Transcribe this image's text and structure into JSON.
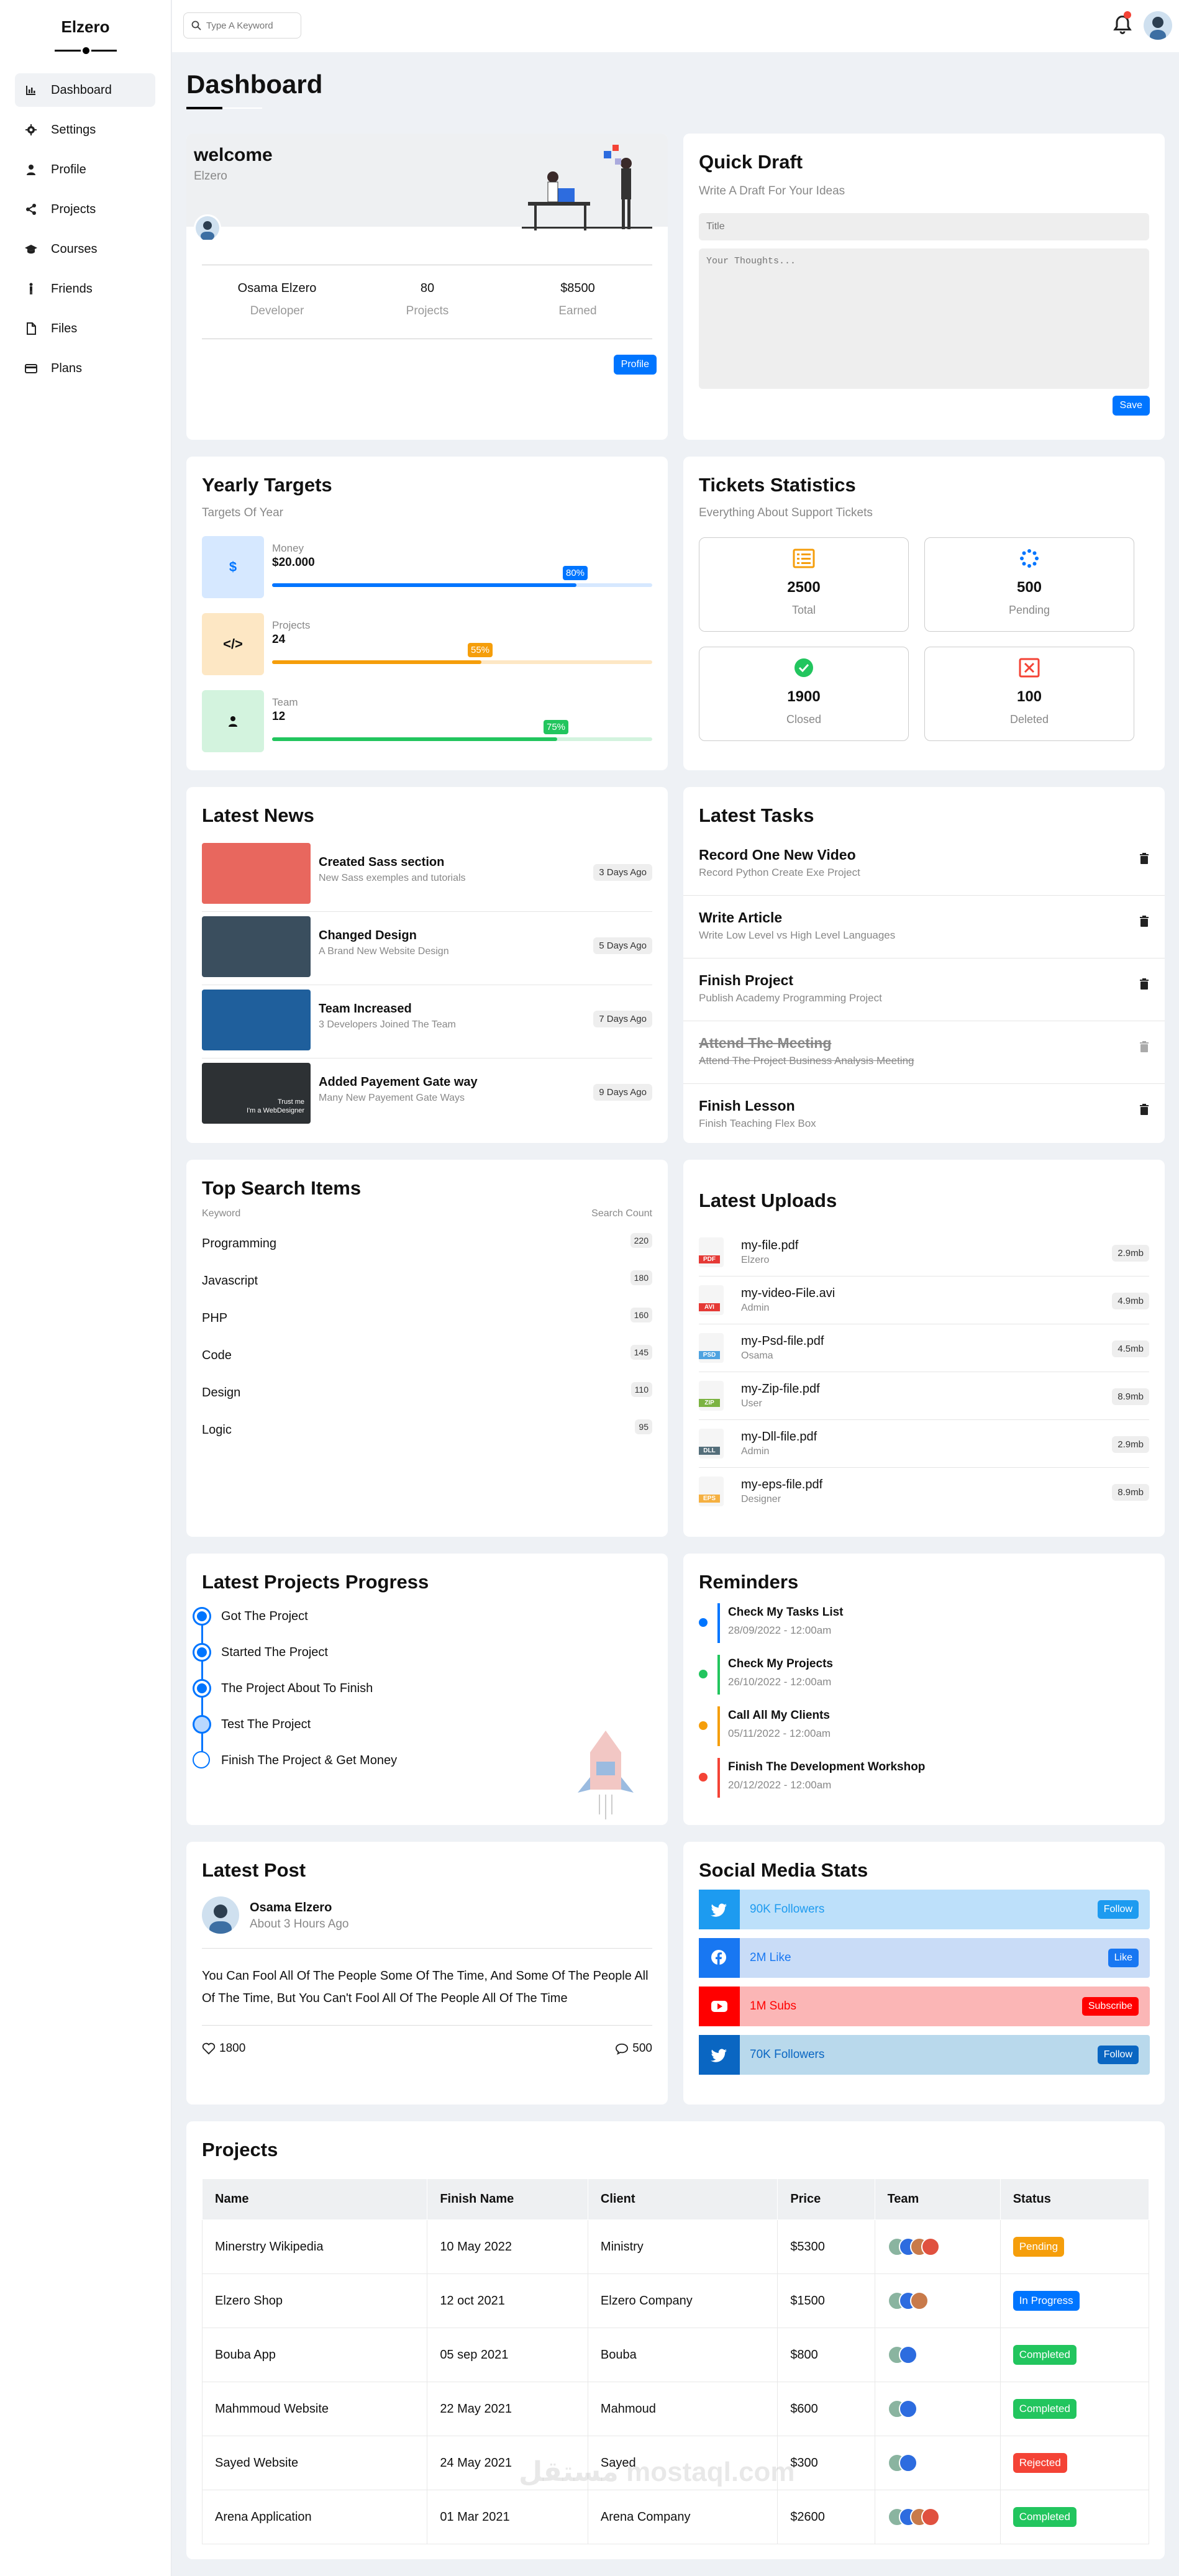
{
  "app": {
    "brand": "Elzero"
  },
  "sidebar": {
    "items": [
      {
        "label": "Dashboard",
        "icon": "chart-icon",
        "active": true
      },
      {
        "label": "Settings",
        "icon": "gear-icon",
        "active": false
      },
      {
        "label": "Profile",
        "icon": "user-icon",
        "active": false
      },
      {
        "label": "Projects",
        "icon": "share-icon",
        "active": false
      },
      {
        "label": "Courses",
        "icon": "graduation-cap-icon",
        "active": false
      },
      {
        "label": "Friends",
        "icon": "person-standing-icon",
        "active": false
      },
      {
        "label": "Files",
        "icon": "file-icon",
        "active": false
      },
      {
        "label": "Plans",
        "icon": "credit-card-icon",
        "active": false
      }
    ]
  },
  "topbar": {
    "search_placeholder": "Type A Keyword",
    "notifications": true
  },
  "page": {
    "title": "Dashboard"
  },
  "welcome": {
    "title": "welcome",
    "subtitle": "Elzero",
    "name": "Osama Elzero",
    "name_label": "Developer",
    "projects": "80",
    "projects_label": "Projects",
    "earned": "$8500",
    "earned_label": "Earned",
    "button": "Profile"
  },
  "quick_draft": {
    "title": "Quick Draft",
    "subtitle": "Write A Draft For Your Ideas",
    "title_placeholder": "Title",
    "body_placeholder": "Your Thoughts...",
    "button": "Save"
  },
  "yearly_targets": {
    "title": "Yearly Targets",
    "subtitle": "Targets Of Year",
    "items": [
      {
        "label": "Money",
        "value": "$20.000",
        "percent": "80%",
        "fraction": 0.8,
        "icon": "$",
        "color": "#0075ff",
        "bg": "#d6e8ff"
      },
      {
        "label": "Projects",
        "value": "24",
        "percent": "55%",
        "fraction": 0.55,
        "icon": "</>",
        "color": "#f59e0b",
        "bg": "#fde7c4"
      },
      {
        "label": "Team",
        "value": "12",
        "percent": "75%",
        "fraction": 0.75,
        "icon": "person",
        "color": "#22c55e",
        "bg": "#d3f3de"
      }
    ]
  },
  "tickets": {
    "title": "Tickets Statistics",
    "subtitle": "Everything About Support Tickets",
    "items": [
      {
        "value": "2500",
        "label": "Total",
        "icon": "list-icon",
        "color": "#f59e0b"
      },
      {
        "value": "500",
        "label": "Pending",
        "icon": "spinner-icon",
        "color": "#0075ff"
      },
      {
        "value": "1900",
        "label": "Closed",
        "icon": "check-circle-icon",
        "color": "#22c55e"
      },
      {
        "value": "100",
        "label": "Deleted",
        "icon": "x-square-icon",
        "color": "#f44336"
      }
    ]
  },
  "news": {
    "title": "Latest News",
    "items": [
      {
        "title": "Created Sass section",
        "desc": "New Sass exemples and tutorials",
        "date": "3 Days Ago",
        "thumb": "#e8675e"
      },
      {
        "title": "Changed Design",
        "desc": "A Brand New Website Design",
        "date": "5 Days Ago",
        "thumb": "#3a4e5e"
      },
      {
        "title": "Team Increased",
        "desc": "3 Developers Joined The Team",
        "date": "7 Days Ago",
        "thumb": "#1f5f9c"
      },
      {
        "title": "Added Payement Gate way",
        "desc": "Many New Payement Gate Ways",
        "date": "9 Days Ago",
        "thumb": "#2d3134",
        "overlay": "Trust me\nI'm a WebDesigner"
      }
    ]
  },
  "tasks": {
    "title": "Latest Tasks",
    "items": [
      {
        "title": "Record One New Video",
        "desc": "Record Python Create Exe Project",
        "done": false
      },
      {
        "title": "Write Article",
        "desc": "Write Low Level vs High Level Languages",
        "done": false
      },
      {
        "title": "Finish Project",
        "desc": "Publish Academy Programming Project",
        "done": false
      },
      {
        "title": "Attend The Meeting",
        "desc": "Attend The Project Business Analysis Meeting",
        "done": true
      },
      {
        "title": "Finish Lesson",
        "desc": "Finish Teaching Flex Box",
        "done": false
      }
    ]
  },
  "search_items": {
    "title": "Top Search Items",
    "col_keyword": "Keyword",
    "col_count": "Search Count",
    "items": [
      {
        "keyword": "Programming",
        "count": "220"
      },
      {
        "keyword": "Javascript",
        "count": "180"
      },
      {
        "keyword": "PHP",
        "count": "160"
      },
      {
        "keyword": "Code",
        "count": "145"
      },
      {
        "keyword": "Design",
        "count": "110"
      },
      {
        "keyword": "Logic",
        "count": "95"
      }
    ]
  },
  "uploads": {
    "title": "Latest Uploads",
    "items": [
      {
        "name": "my-file.pdf",
        "owner": "Elzero",
        "size": "2.9mb",
        "type": "PDF",
        "color": "#e53935"
      },
      {
        "name": "my-video-File.avi",
        "owner": "Admin",
        "size": "4.9mb",
        "type": "AVI",
        "color": "#e53935"
      },
      {
        "name": "my-Psd-file.pdf",
        "owner": "Osama",
        "size": "4.5mb",
        "type": "PSD",
        "color": "#4fa3e0"
      },
      {
        "name": "my-Zip-file.pdf",
        "owner": "User",
        "size": "8.9mb",
        "type": "ZIP",
        "color": "#7cb342"
      },
      {
        "name": "my-Dll-file.pdf",
        "owner": "Admin",
        "size": "2.9mb",
        "type": "DLL",
        "color": "#546e7a"
      },
      {
        "name": "my-eps-file.pdf",
        "owner": "Designer",
        "size": "8.9mb",
        "type": "EPS",
        "color": "#f5b041"
      }
    ]
  },
  "progress": {
    "title": "Latest Projects Progress",
    "items": [
      {
        "label": "Got The Project",
        "state": "done"
      },
      {
        "label": "Started The Project",
        "state": "done"
      },
      {
        "label": "The Project About To Finish",
        "state": "done"
      },
      {
        "label": "Test The Project",
        "state": "current"
      },
      {
        "label": "Finish The Project & Get Money",
        "state": "todo"
      }
    ]
  },
  "reminders": {
    "title": "Reminders",
    "items": [
      {
        "title": "Check My Tasks List",
        "date": "28/09/2022 - 12:00am",
        "color": "#0075ff"
      },
      {
        "title": "Check My Projects",
        "date": "26/10/2022 - 12:00am",
        "color": "#22c55e"
      },
      {
        "title": "Call All My Clients",
        "date": "05/11/2022 - 12:00am",
        "color": "#f59e0b"
      },
      {
        "title": "Finish The Development Workshop",
        "date": "20/12/2022 - 12:00am",
        "color": "#f44336"
      }
    ]
  },
  "post": {
    "title": "Latest Post",
    "author": "Osama Elzero",
    "time": "About 3 Hours Ago",
    "text": "You Can Fool All Of The People Some Of The Time, And Some Of The People All Of The Time, But You Can't Fool All Of The People All Of The Time",
    "likes": "1800",
    "comments": "500"
  },
  "social": {
    "title": "Social Media Stats",
    "items": [
      {
        "text": "90K Followers",
        "button": "Follow",
        "icon": "twitter-icon",
        "bg": "#bde0fa",
        "icon_bg": "#1d9bf0",
        "btn_bg": "#1d9bf0",
        "color": "#1d9bf0"
      },
      {
        "text": "2M Like",
        "button": "Like",
        "icon": "facebook-icon",
        "bg": "#c9dcf7",
        "icon_bg": "#1877f2",
        "btn_bg": "#1877f2",
        "color": "#1877f2"
      },
      {
        "text": "1M Subs",
        "button": "Subscribe",
        "icon": "youtube-icon",
        "bg": "#fbb6b6",
        "icon_bg": "#ff0000",
        "btn_bg": "#ff0000",
        "color": "#ff0000"
      },
      {
        "text": "70K Followers",
        "button": "Follow",
        "icon": "twitter-icon",
        "bg": "#b9d9ec",
        "icon_bg": "#0a66c2",
        "btn_bg": "#0a66c2",
        "color": "#0a66c2"
      }
    ]
  },
  "projects": {
    "title": "Projects",
    "columns": [
      "Name",
      "Finish Name",
      "Client",
      "Price",
      "Team",
      "Status"
    ],
    "rows": [
      {
        "name": "Minerstry Wikipedia",
        "finish": "10 May 2022",
        "client": "Ministry",
        "price": "$5300",
        "team": 4,
        "status": "Pending",
        "status_color": "#f59e0b"
      },
      {
        "name": "Elzero Shop",
        "finish": "12 oct 2021",
        "client": "Elzero Company",
        "price": "$1500",
        "team": 3,
        "status": "In Progress",
        "status_color": "#0075ff"
      },
      {
        "name": "Bouba App",
        "finish": "05 sep 2021",
        "client": "Bouba",
        "price": "$800",
        "team": 2,
        "status": "Completed",
        "status_color": "#22c55e"
      },
      {
        "name": "Mahmmoud Website",
        "finish": "22 May 2021",
        "client": "Mahmoud",
        "price": "$600",
        "team": 2,
        "status": "Completed",
        "status_color": "#22c55e"
      },
      {
        "name": "Sayed Website",
        "finish": "24 May 2021",
        "client": "Sayed",
        "price": "$300",
        "team": 2,
        "status": "Rejected",
        "status_color": "#f44336"
      },
      {
        "name": "Arena Application",
        "finish": "01 Mar 2021",
        "client": "Arena Company",
        "price": "$2600",
        "team": 4,
        "status": "Completed",
        "status_color": "#22c55e"
      }
    ]
  },
  "watermark": "مستقل mostaql.com"
}
